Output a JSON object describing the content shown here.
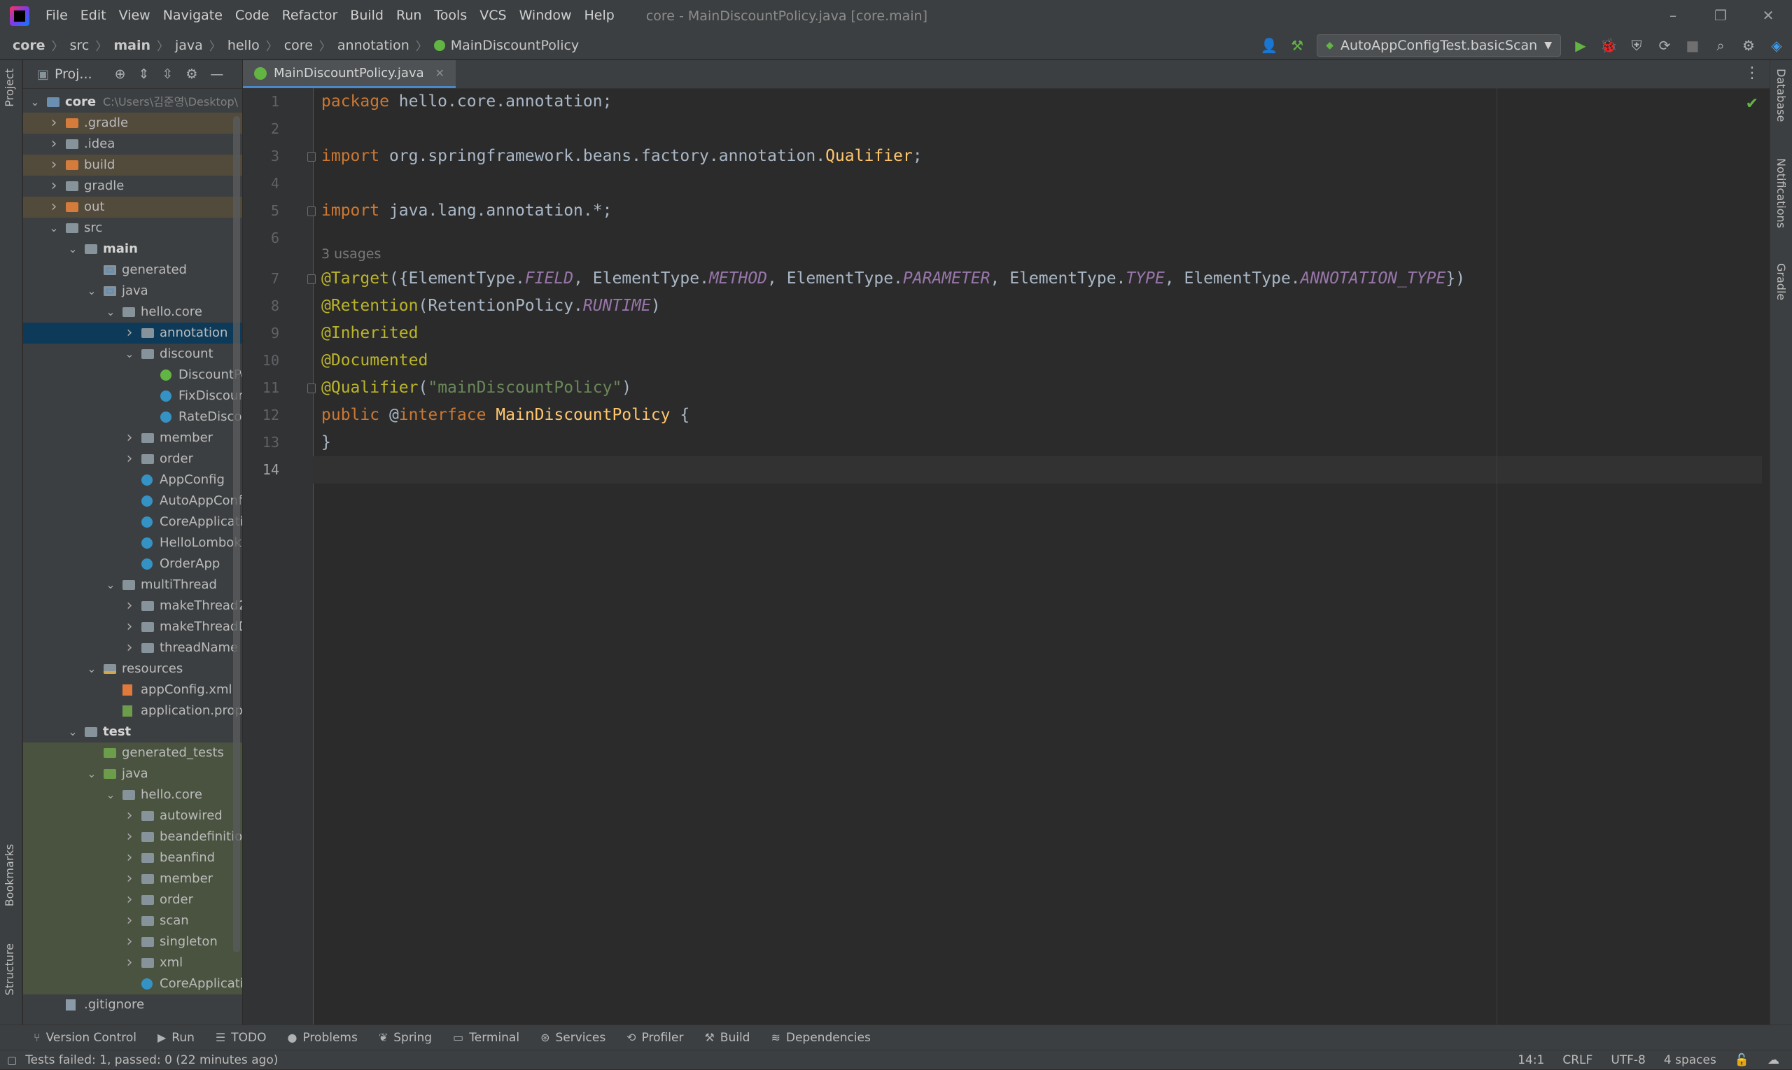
{
  "menu": {
    "items": [
      "File",
      "Edit",
      "View",
      "Navigate",
      "Code",
      "Refactor",
      "Build",
      "Run",
      "Tools",
      "VCS",
      "Window",
      "Help"
    ],
    "window_title": "core - MainDiscountPolicy.java [core.main]"
  },
  "breadcrumbs": [
    "core",
    "src",
    "main",
    "java",
    "hello",
    "core",
    "annotation",
    "MainDiscountPolicy"
  ],
  "run_config": "AutoAppConfigTest.basicScan",
  "left_stripe": {
    "project": "Project",
    "bookmarks": "Bookmarks",
    "structure": "Structure"
  },
  "right_stripe": {
    "database": "Database",
    "notifications": "Notifications",
    "gradle": "Gradle"
  },
  "project_panel": {
    "title": "Proj...",
    "tree": [
      {
        "label": "core",
        "path": "C:\\Users\\김준영\\Desktop\\",
        "indent": 0,
        "chev": "down",
        "icon": "module",
        "bold": true,
        "style": ""
      },
      {
        "label": ".gradle",
        "indent": 1,
        "chev": "right",
        "icon": "folder-ex",
        "style": "excluded"
      },
      {
        "label": ".idea",
        "indent": 1,
        "chev": "right",
        "icon": "folder",
        "style": ""
      },
      {
        "label": "build",
        "indent": 1,
        "chev": "right",
        "icon": "folder-ex",
        "style": "excluded"
      },
      {
        "label": "gradle",
        "indent": 1,
        "chev": "right",
        "icon": "folder",
        "style": ""
      },
      {
        "label": "out",
        "indent": 1,
        "chev": "right",
        "icon": "folder-ex",
        "style": "excluded"
      },
      {
        "label": "src",
        "indent": 1,
        "chev": "down",
        "icon": "folder",
        "style": ""
      },
      {
        "label": "main",
        "indent": 2,
        "chev": "down",
        "icon": "folder",
        "bold": true,
        "style": ""
      },
      {
        "label": "generated",
        "indent": 3,
        "chev": "",
        "icon": "folder-src",
        "style": ""
      },
      {
        "label": "java",
        "indent": 3,
        "chev": "down",
        "icon": "folder-src",
        "style": ""
      },
      {
        "label": "hello.core",
        "indent": 4,
        "chev": "down",
        "icon": "folder",
        "style": ""
      },
      {
        "label": "annotation",
        "indent": 5,
        "chev": "right",
        "icon": "folder",
        "style": "selected"
      },
      {
        "label": "discount",
        "indent": 5,
        "chev": "down",
        "icon": "folder",
        "style": ""
      },
      {
        "label": "DiscountPolicy",
        "indent": 6,
        "chev": "",
        "icon": "iface",
        "style": ""
      },
      {
        "label": "FixDiscountPolicy",
        "indent": 6,
        "chev": "",
        "icon": "class",
        "style": ""
      },
      {
        "label": "RateDiscountPolicy",
        "indent": 6,
        "chev": "",
        "icon": "class",
        "style": ""
      },
      {
        "label": "member",
        "indent": 5,
        "chev": "right",
        "icon": "folder",
        "style": ""
      },
      {
        "label": "order",
        "indent": 5,
        "chev": "right",
        "icon": "folder",
        "style": ""
      },
      {
        "label": "AppConfig",
        "indent": 5,
        "chev": "",
        "icon": "class",
        "style": ""
      },
      {
        "label": "AutoAppConfig",
        "indent": 5,
        "chev": "",
        "icon": "class",
        "style": ""
      },
      {
        "label": "CoreApplication",
        "indent": 5,
        "chev": "",
        "icon": "class",
        "style": ""
      },
      {
        "label": "HelloLombok",
        "indent": 5,
        "chev": "",
        "icon": "class",
        "style": ""
      },
      {
        "label": "OrderApp",
        "indent": 5,
        "chev": "",
        "icon": "class",
        "style": ""
      },
      {
        "label": "multiThread",
        "indent": 4,
        "chev": "down",
        "icon": "folder",
        "style": ""
      },
      {
        "label": "makeThread2",
        "indent": 5,
        "chev": "right",
        "icon": "folder",
        "style": ""
      },
      {
        "label": "makeThreadDirect",
        "indent": 5,
        "chev": "right",
        "icon": "folder",
        "style": ""
      },
      {
        "label": "threadName",
        "indent": 5,
        "chev": "right",
        "icon": "folder",
        "style": ""
      },
      {
        "label": "resources",
        "indent": 3,
        "chev": "down",
        "icon": "folder-res",
        "style": ""
      },
      {
        "label": "appConfig.xml",
        "indent": 4,
        "chev": "",
        "icon": "xml",
        "style": ""
      },
      {
        "label": "application.properties",
        "indent": 4,
        "chev": "",
        "icon": "prop",
        "style": ""
      },
      {
        "label": "test",
        "indent": 2,
        "chev": "down",
        "icon": "folder",
        "bold": true,
        "style": ""
      },
      {
        "label": "generated_tests",
        "indent": 3,
        "chev": "",
        "icon": "folder-green",
        "style": "test"
      },
      {
        "label": "java",
        "indent": 3,
        "chev": "down",
        "icon": "folder-green",
        "style": "test"
      },
      {
        "label": "hello.core",
        "indent": 4,
        "chev": "down",
        "icon": "folder",
        "style": "test"
      },
      {
        "label": "autowired",
        "indent": 5,
        "chev": "right",
        "icon": "folder",
        "style": "test"
      },
      {
        "label": "beandefinition",
        "indent": 5,
        "chev": "right",
        "icon": "folder",
        "style": "test"
      },
      {
        "label": "beanfind",
        "indent": 5,
        "chev": "right",
        "icon": "folder",
        "style": "test"
      },
      {
        "label": "member",
        "indent": 5,
        "chev": "right",
        "icon": "folder",
        "style": "test"
      },
      {
        "label": "order",
        "indent": 5,
        "chev": "right",
        "icon": "folder",
        "style": "test"
      },
      {
        "label": "scan",
        "indent": 5,
        "chev": "right",
        "icon": "folder",
        "style": "test"
      },
      {
        "label": "singleton",
        "indent": 5,
        "chev": "right",
        "icon": "folder",
        "style": "test"
      },
      {
        "label": "xml",
        "indent": 5,
        "chev": "right",
        "icon": "folder",
        "style": "test"
      },
      {
        "label": "CoreApplicationTests",
        "indent": 5,
        "chev": "",
        "icon": "class",
        "style": "test"
      },
      {
        "label": ".gitignore",
        "indent": 1,
        "chev": "",
        "icon": "file",
        "style": ""
      }
    ]
  },
  "editor": {
    "tab_label": "MainDiscountPolicy.java",
    "line_numbers": [
      "1",
      "2",
      "3",
      "4",
      "5",
      "6",
      "7",
      "8",
      "9",
      "10",
      "11",
      "12",
      "13",
      "14"
    ],
    "usages_hint": "3 usages",
    "code": {
      "l1": [
        "package",
        " hello.core.annotation;"
      ],
      "l3": [
        "import",
        " org.springframework.beans.factory.annotation.",
        "Qualifier",
        ";"
      ],
      "l5": [
        "import",
        " java.lang.annotation.*;"
      ],
      "l7": [
        "@Target",
        "({ElementType.",
        "FIELD",
        ", ElementType.",
        "METHOD",
        ", ElementType.",
        "PARAMETER",
        ", ElementType.",
        "TYPE",
        ", ElementType.",
        "ANNOTATION_TYPE",
        "})"
      ],
      "l8": [
        "@Retention",
        "(RetentionPolicy.",
        "RUNTIME",
        ")"
      ],
      "l9": [
        "@Inherited"
      ],
      "l10": [
        "@Documented"
      ],
      "l11": [
        "@Qualifier",
        "(",
        "\"mainDiscountPolicy\"",
        ")"
      ],
      "l12": [
        "public",
        " @",
        "interface",
        " ",
        "MainDiscountPolicy",
        " {"
      ],
      "l13": [
        "}"
      ]
    }
  },
  "tool_windows": [
    "Version Control",
    "Run",
    "TODO",
    "Problems",
    "Spring",
    "Terminal",
    "Services",
    "Profiler",
    "Build",
    "Dependencies"
  ],
  "status": {
    "message": "Tests failed: 1, passed: 0 (22 minutes ago)",
    "position": "14:1",
    "line_sep": "CRLF",
    "encoding": "UTF-8",
    "indent": "4 spaces"
  }
}
